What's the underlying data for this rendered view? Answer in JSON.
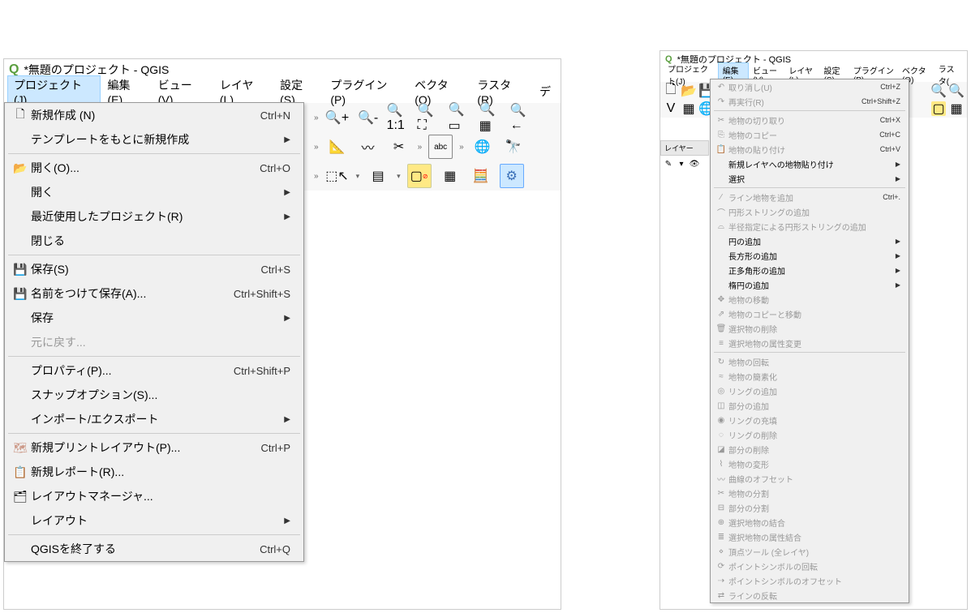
{
  "title": "*無題のプロジェクト - QGIS",
  "menuBar": {
    "project": "プロジェクト(J)",
    "edit": "編集(E)",
    "view": "ビュー(V)",
    "layer": "レイヤ(L)",
    "settings": "設定(S)",
    "plugins": "プラグイン(P)",
    "vector": "ベクタ(O)",
    "raster": "ラスタ(R)",
    "db": "デ"
  },
  "menuBarSmall": {
    "project": "プロジェクト(J)",
    "edit": "編集(E)",
    "view": "ビュー(V)",
    "layer": "レイヤ(L)",
    "settings": "設定(S)",
    "plugins": "プラグイン(P)",
    "vector": "ベクタ(O)",
    "raster": "ラスタ("
  },
  "projectMenu": {
    "new": {
      "label": "新規作成 (N)",
      "shortcut": "Ctrl+N"
    },
    "newFromTemplate": {
      "label": "テンプレートをもとに新規作成"
    },
    "open": {
      "label": "開く(O)...",
      "shortcut": "Ctrl+O"
    },
    "openFrom": {
      "label": "開く"
    },
    "recent": {
      "label": "最近使用したプロジェクト(R)"
    },
    "close": {
      "label": "閉じる"
    },
    "save": {
      "label": "保存(S)",
      "shortcut": "Ctrl+S"
    },
    "saveAs": {
      "label": "名前をつけて保存(A)...",
      "shortcut": "Ctrl+Shift+S"
    },
    "saveTo": {
      "label": "保存"
    },
    "revert": {
      "label": "元に戻す..."
    },
    "properties": {
      "label": "プロパティ(P)...",
      "shortcut": "Ctrl+Shift+P"
    },
    "snap": {
      "label": "スナップオプション(S)..."
    },
    "importExport": {
      "label": "インポート/エクスポート"
    },
    "newPrintLayout": {
      "label": "新規プリントレイアウト(P)...",
      "shortcut": "Ctrl+P"
    },
    "newReport": {
      "label": "新規レポート(R)..."
    },
    "layoutManager": {
      "label": "レイアウトマネージャ..."
    },
    "layouts": {
      "label": "レイアウト"
    },
    "exit": {
      "label": "QGISを終了する",
      "shortcut": "Ctrl+Q"
    }
  },
  "editMenu": {
    "undo": {
      "label": "取り消し(U)",
      "shortcut": "Ctrl+Z"
    },
    "redo": {
      "label": "再実行(R)",
      "shortcut": "Ctrl+Shift+Z"
    },
    "cut": {
      "label": "地物の切り取り",
      "shortcut": "Ctrl+X"
    },
    "copy": {
      "label": "地物のコピー",
      "shortcut": "Ctrl+C"
    },
    "paste": {
      "label": "地物の貼り付け",
      "shortcut": "Ctrl+V"
    },
    "pasteAs": {
      "label": "新規レイヤへの地物貼り付け"
    },
    "select": {
      "label": "選択"
    },
    "addLine": {
      "label": "ライン地物を追加",
      "shortcut": "Ctrl+."
    },
    "addCircString": {
      "label": "円形ストリングの追加"
    },
    "addCircStringRadius": {
      "label": "半径指定による円形ストリングの追加"
    },
    "addCircle": {
      "label": "円の追加"
    },
    "addRect": {
      "label": "長方形の追加"
    },
    "addPolygon": {
      "label": "正多角形の追加"
    },
    "addEllipse": {
      "label": "楕円の追加"
    },
    "move": {
      "label": "地物の移動"
    },
    "copyMove": {
      "label": "地物のコピーと移動"
    },
    "deleteSel": {
      "label": "選択物の削除"
    },
    "modifyAttr": {
      "label": "選択地物の属性変更"
    },
    "rotate": {
      "label": "地物の回転"
    },
    "simplify": {
      "label": "地物の簡素化"
    },
    "addRing": {
      "label": "リングの追加"
    },
    "addPart": {
      "label": "部分の追加"
    },
    "fillRing": {
      "label": "リングの充填"
    },
    "deleteRing": {
      "label": "リングの削除"
    },
    "deletePart": {
      "label": "部分の削除"
    },
    "reshape": {
      "label": "地物の変形"
    },
    "offsetCurve": {
      "label": "曲線のオフセット"
    },
    "split": {
      "label": "地物の分割"
    },
    "splitParts": {
      "label": "部分の分割"
    },
    "mergeSelected": {
      "label": "選択地物の結合"
    },
    "mergeAttr": {
      "label": "選択地物の属性結合"
    },
    "vertexTool": {
      "label": "頂点ツール (全レイヤ)"
    },
    "rotateSymbol": {
      "label": "ポイントシンボルの回転"
    },
    "offsetSymbol": {
      "label": "ポイントシンボルのオフセット"
    },
    "reverseLine": {
      "label": "ラインの反転"
    }
  },
  "layersPanel": {
    "title": "レイヤー"
  }
}
